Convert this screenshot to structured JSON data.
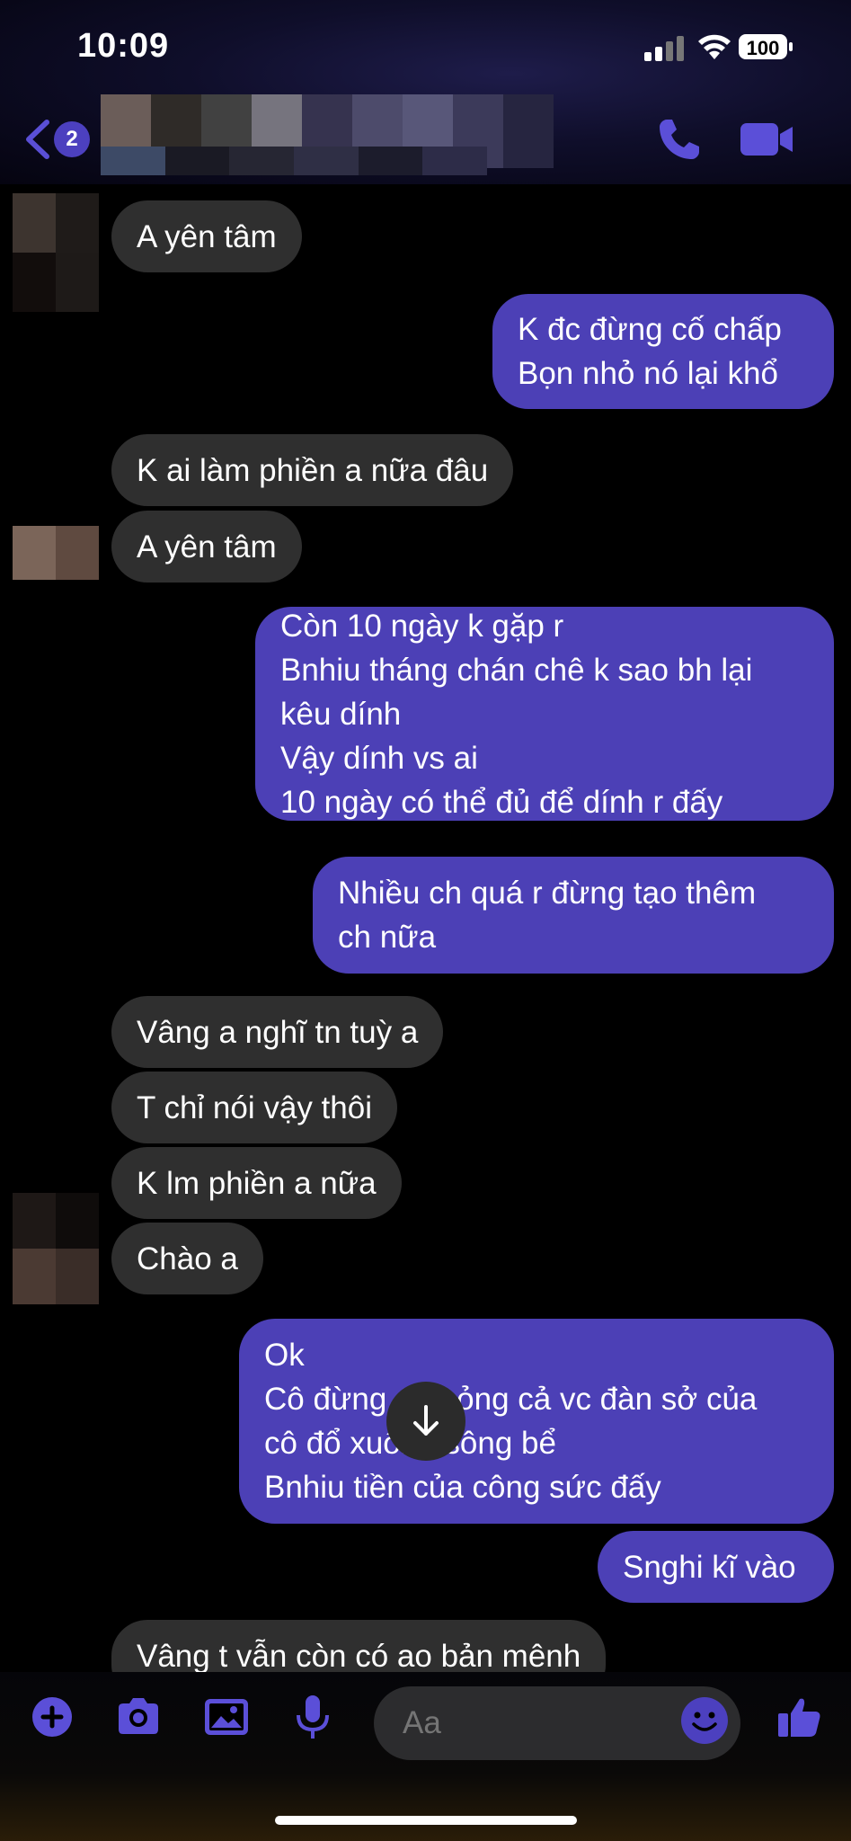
{
  "status_bar": {
    "time": "10:09",
    "battery": "100"
  },
  "nav": {
    "unread_count": "2"
  },
  "composer": {
    "placeholder": "Aa"
  },
  "colors": {
    "outgoing_bubble": "#4c40b6",
    "incoming_bubble": "#2f2f2f",
    "accent": "#4c40bf"
  },
  "messages": [
    {
      "dir": "in",
      "text": "A yên tâm"
    },
    {
      "dir": "out",
      "text": "K đc đừng cố chấp\nBọn nhỏ nó lại khổ"
    },
    {
      "dir": "in",
      "text": "K ai làm phiền a nữa đâu"
    },
    {
      "dir": "in",
      "text": "A yên tâm"
    },
    {
      "dir": "out",
      "text": "Còn 10 ngày k gặp r\nBnhiu tháng chán chê k sao bh lại\nkêu dính\nVậy dính vs ai\n10 ngày có thể đủ để dính r đấy"
    },
    {
      "dir": "out",
      "text": "Nhiều ch quá r đừng tạo thêm\nch nữa"
    },
    {
      "dir": "in",
      "text": "Vâng a nghĩ tn tuỳ a"
    },
    {
      "dir": "in",
      "text": "T chỉ nói vậy thôi"
    },
    {
      "dir": "in",
      "text": "K lm phiền a nữa"
    },
    {
      "dir": "in",
      "text": "Chào a"
    },
    {
      "dir": "out",
      "text": "Ok\nCô đừng để hỏng cả vc đàn sở của\ncô đổ xuống sông bể\nBnhiu tiền của công sức đấy"
    },
    {
      "dir": "out",
      "text": "Snghi kĩ vào"
    },
    {
      "dir": "in",
      "text": "Vâng t vẫn còn có ao bản mênh"
    }
  ]
}
